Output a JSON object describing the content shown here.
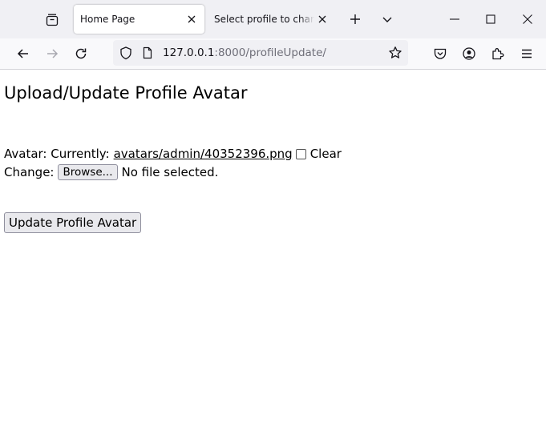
{
  "browser": {
    "tabs": [
      {
        "title": "Home Page",
        "active": true
      },
      {
        "title": "Select profile to change | Dj",
        "active": false
      }
    ],
    "url": {
      "host": "127.0.0.1",
      "rest": ":8000/profileUpdate/"
    },
    "icons": {
      "tab_overview": "tab-overview-icon",
      "new_tab": "plus-icon",
      "list_tabs": "chevron-down-icon",
      "back": "back-arrow-icon",
      "forward": "forward-arrow-icon",
      "reload": "reload-icon",
      "shield": "shield-icon",
      "page": "page-icon",
      "bookmark": "star-icon",
      "pocket": "pocket-icon",
      "account": "account-icon",
      "extensions": "puzzle-icon",
      "menu": "hamburger-menu-icon"
    }
  },
  "page": {
    "heading": "Upload/Update Profile Avatar",
    "avatar": {
      "label": "Avatar: Currently:",
      "current_file": "avatars/admin/40352396.png",
      "clear_label": "Clear",
      "change_label": "Change:",
      "browse_label": "Browse...",
      "file_status": "No file selected."
    },
    "submit_label": "Update Profile Avatar"
  }
}
